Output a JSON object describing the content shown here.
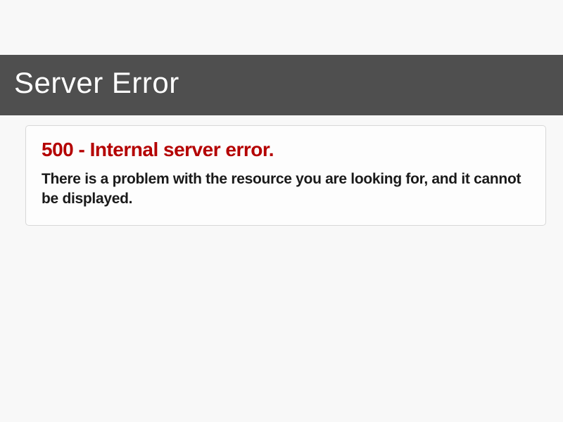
{
  "banner": {
    "title": "Server Error"
  },
  "error": {
    "title": "500 - Internal server error.",
    "message": "There is a problem with the resource you are looking for, and it cannot be displayed."
  }
}
